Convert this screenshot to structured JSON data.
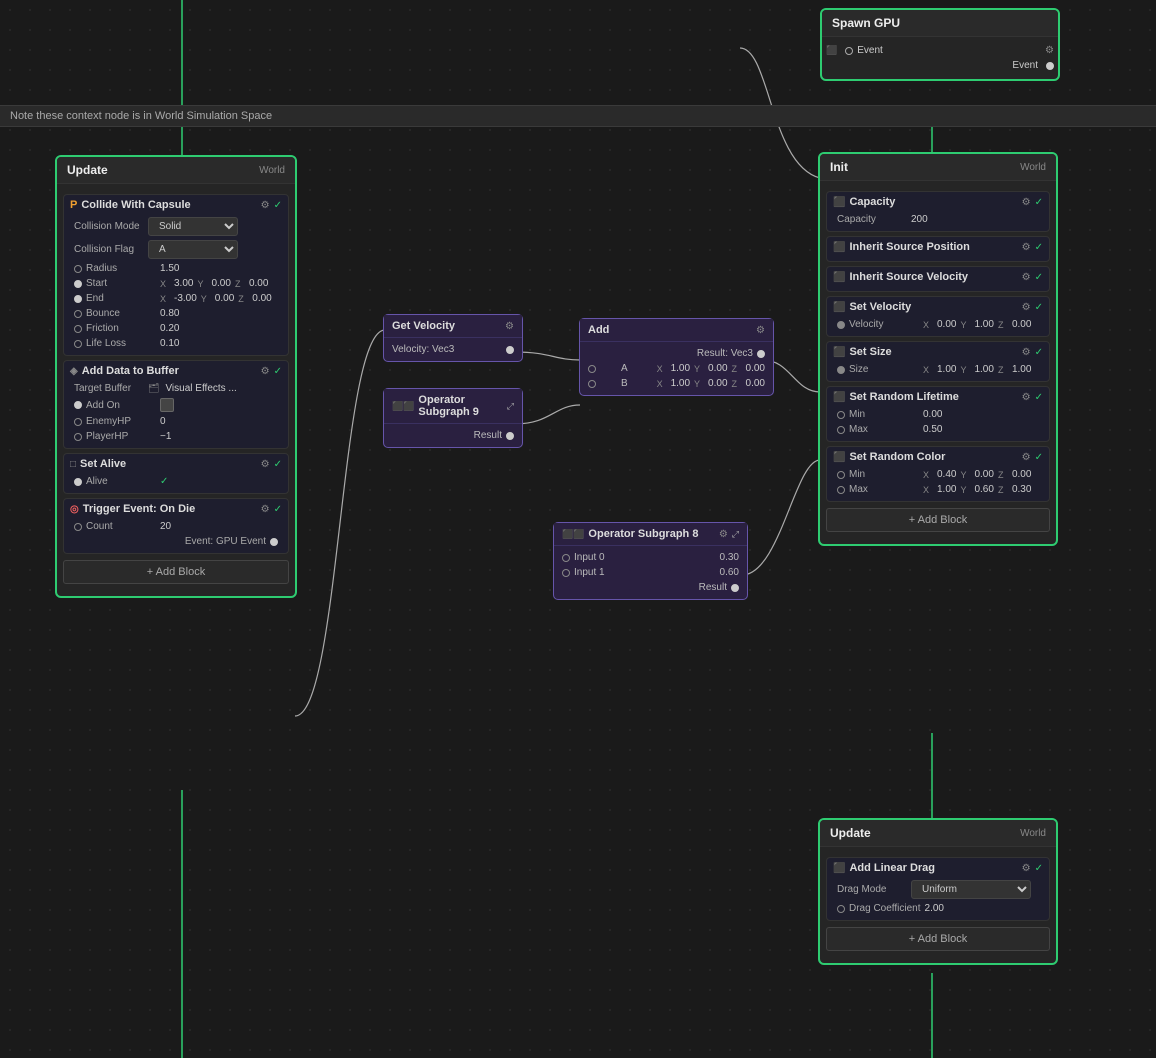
{
  "note": "Note these context node is in World Simulation Space",
  "spawnGPU": {
    "title": "Spawn GPU",
    "ports": [
      {
        "label": "Event",
        "type": "input"
      },
      {
        "label": "Event",
        "type": "output"
      }
    ]
  },
  "initNode": {
    "title": "Init",
    "subtitle": "World",
    "blocks": [
      {
        "name": "Capacity",
        "fields": [
          {
            "label": "Capacity",
            "value": "200"
          }
        ]
      },
      {
        "name": "Inherit Source Position",
        "fields": []
      },
      {
        "name": "Inherit Source Velocity",
        "fields": []
      },
      {
        "name": "Set Velocity",
        "fields": [
          {
            "label": "Velocity",
            "x": "0.00",
            "y": "1.00",
            "z": "0.00"
          }
        ]
      },
      {
        "name": "Set Size",
        "fields": [
          {
            "label": "Size",
            "x": "1.00",
            "y": "1.00",
            "z": "1.00"
          }
        ]
      },
      {
        "name": "Set Random Lifetime",
        "fields": [
          {
            "label": "Min",
            "value": "0.00"
          },
          {
            "label": "Max",
            "value": "0.50"
          }
        ]
      },
      {
        "name": "Set Random Color",
        "fields": [
          {
            "label": "Min",
            "x": "0.40",
            "y": "0.00",
            "z": "0.00"
          },
          {
            "label": "Max",
            "x": "1.00",
            "y": "0.60",
            "z": "0.30"
          }
        ]
      }
    ],
    "addBlockLabel": "+ Add Block"
  },
  "updateNodeLeft": {
    "title": "Update",
    "subtitle": "World",
    "blocks": [
      {
        "name": "Collide With Capsule",
        "icon": "phy",
        "fields": [
          {
            "label": "Collision Mode",
            "type": "select",
            "value": "Solid"
          },
          {
            "label": "Collision Flag",
            "type": "select",
            "value": "A"
          },
          {
            "label": "Radius",
            "value": "1.50"
          },
          {
            "label": "Start",
            "x": "3.00",
            "y": "0.00",
            "z": "0.00"
          },
          {
            "label": "End",
            "x": "-3.00",
            "y": "0.00",
            "z": "0.00"
          },
          {
            "label": "Bounce",
            "value": "0.80"
          },
          {
            "label": "Friction",
            "value": "0.20"
          },
          {
            "label": "Life Loss",
            "value": "0.10"
          }
        ]
      },
      {
        "name": "Add Data to Buffer",
        "icon": "buf",
        "fields": [
          {
            "label": "Target Buffer",
            "value": "Visual Effects ..."
          },
          {
            "label": "Add On",
            "value": "checkbox"
          },
          {
            "label": "EnemyHP",
            "value": "0"
          },
          {
            "label": "PlayerHP",
            "value": "-1"
          }
        ]
      },
      {
        "name": "Set Alive",
        "icon": "box",
        "fields": [
          {
            "label": "Alive",
            "value": "checked"
          }
        ]
      },
      {
        "name": "Trigger Event: On Die",
        "icon": "trigger",
        "fields": [
          {
            "label": "Count",
            "value": "20"
          },
          {
            "label": "Event",
            "value": "GPU Event"
          }
        ]
      }
    ],
    "addBlockLabel": "+ Add Block"
  },
  "updateNodeRight": {
    "title": "Update",
    "subtitle": "World",
    "blocks": [
      {
        "name": "Add Linear Drag",
        "icon": "drag",
        "fields": [
          {
            "label": "Drag Mode",
            "type": "select",
            "value": "Uniform"
          },
          {
            "label": "Drag Coefficient",
            "value": "2.00"
          }
        ]
      }
    ],
    "addBlockLabel": "+ Add Block"
  },
  "getVelocityNode": {
    "title": "Get Velocity",
    "port": "Velocity: Vec3"
  },
  "addNode": {
    "title": "Add",
    "ports": {
      "result": "Result: Vec3",
      "a": {
        "x": "1.00",
        "y": "0.00",
        "z": "0.00"
      },
      "b": {
        "x": "1.00",
        "y": "0.00",
        "z": "0.00"
      }
    }
  },
  "opSubgraph9": {
    "title": "Operator Subgraph 9",
    "result": "Result"
  },
  "opSubgraph8": {
    "title": "Operator Subgraph 8",
    "inputs": [
      {
        "label": "Input 0",
        "value": "0.30"
      },
      {
        "label": "Input 1",
        "value": "0.60"
      }
    ],
    "result": "Result"
  },
  "colors": {
    "green": "#2ecc71",
    "purple": "#6655aa",
    "darkBg": "#1a1a1a",
    "nodeBg": "#252525",
    "blockBg": "#1e1e2e"
  }
}
